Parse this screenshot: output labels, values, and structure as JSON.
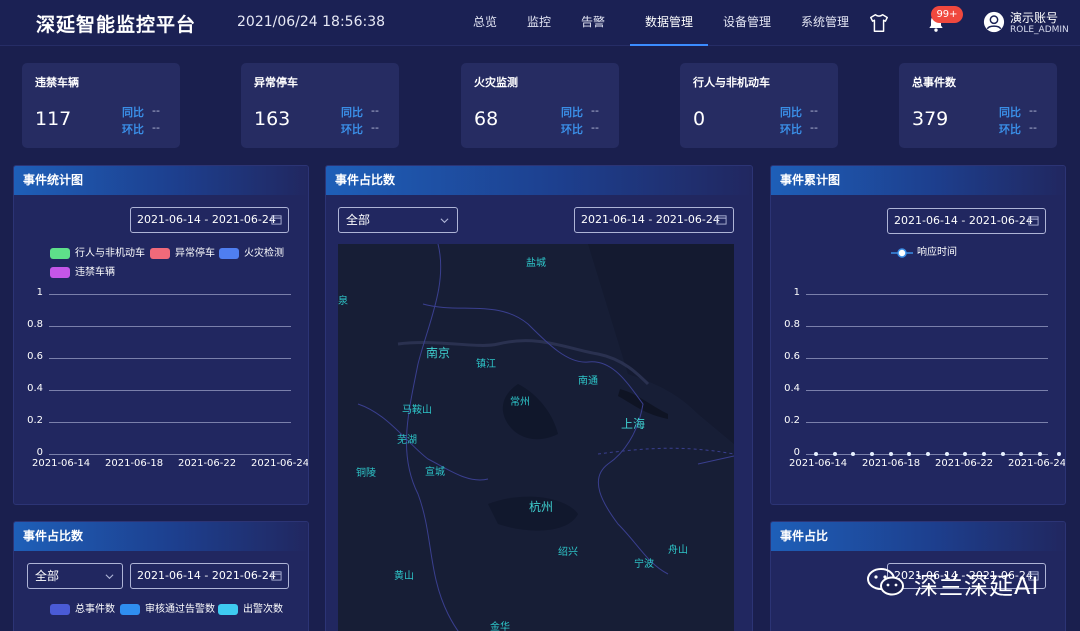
{
  "header": {
    "title": "深延智能监控平台",
    "datetime": "2021/06/24 18:56:38",
    "nav": [
      {
        "label": "总览"
      },
      {
        "label": "监控"
      },
      {
        "label": "告警"
      },
      {
        "label": "数据管理",
        "active": true
      },
      {
        "label": "设备管理"
      },
      {
        "label": "系统管理"
      }
    ],
    "notification_count": "99+",
    "user_name": "演示账号",
    "user_role": "ROLE_ADMIN"
  },
  "stats": [
    {
      "title": "违禁车辆",
      "value": "117",
      "yoy_label": "同比",
      "yoy_value": "--",
      "mom_label": "环比",
      "mom_value": "--"
    },
    {
      "title": "异常停车",
      "value": "163",
      "yoy_label": "同比",
      "yoy_value": "--",
      "mom_label": "环比",
      "mom_value": "--"
    },
    {
      "title": "火灾监测",
      "value": "68",
      "yoy_label": "同比",
      "yoy_value": "--",
      "mom_label": "环比",
      "mom_value": "--"
    },
    {
      "title": "行人与非机动车",
      "value": "0",
      "yoy_label": "同比",
      "yoy_value": "--",
      "mom_label": "环比",
      "mom_value": "--"
    },
    {
      "title": "总事件数",
      "value": "379",
      "yoy_label": "同比",
      "yoy_value": "--",
      "mom_label": "环比",
      "mom_value": "--"
    }
  ],
  "panel_event_stats": {
    "title": "事件统计图",
    "date_range": "2021-06-14 - 2021-06-24",
    "legend": [
      {
        "name": "行人与非机动车",
        "color": "#5ee08a"
      },
      {
        "name": "异常停车",
        "color": "#f06a7a"
      },
      {
        "name": "火灾检测",
        "color": "#4f7ef0"
      },
      {
        "name": "违禁车辆",
        "color": "#c456e8"
      }
    ]
  },
  "panel_event_ratio_map": {
    "title": "事件占比数",
    "select_value": "全部",
    "date_range": "2021-06-14 - 2021-06-24",
    "cities": [
      {
        "name": "盐城"
      },
      {
        "name": "泉"
      },
      {
        "name": "南京"
      },
      {
        "name": "镇江"
      },
      {
        "name": "南通"
      },
      {
        "name": "马鞍山"
      },
      {
        "name": "常州"
      },
      {
        "name": "上海"
      },
      {
        "name": "芜湖"
      },
      {
        "name": "铜陵"
      },
      {
        "name": "宣城"
      },
      {
        "name": "杭州"
      },
      {
        "name": "舟山"
      },
      {
        "name": "绍兴"
      },
      {
        "name": "宁波"
      },
      {
        "name": "黄山"
      },
      {
        "name": "金华"
      }
    ]
  },
  "panel_event_cumulative": {
    "title": "事件累计图",
    "date_range": "2021-06-14 - 2021-06-24",
    "legend_series": "响应时间"
  },
  "panel_event_ratio_bottom": {
    "title": "事件占比数",
    "select_value": "全部",
    "date_range": "2021-06-14 - 2021-06-24",
    "legend": [
      {
        "name": "总事件数",
        "color": "#4a5bd6"
      },
      {
        "name": "审核通过告警数",
        "color": "#2f8ef0"
      },
      {
        "name": "出警次数",
        "color": "#3ecbf0"
      }
    ]
  },
  "panel_event_share": {
    "title": "事件占比",
    "date_range": "2021-06-14 - 2021-06-24"
  },
  "watermark": {
    "text": "深兰深延AI"
  },
  "chart_data": [
    {
      "type": "bar",
      "categories": [
        "2021-06-14",
        "2021-06-18",
        "2021-06-22",
        "2021-06-24"
      ],
      "series": [
        {
          "name": "行人与非机动车",
          "values": []
        },
        {
          "name": "异常停车",
          "values": []
        },
        {
          "name": "火灾检测",
          "values": []
        },
        {
          "name": "违禁车辆",
          "values": []
        }
      ],
      "yticks": [
        "1",
        "0.8",
        "0.6",
        "0.4",
        "0.2",
        "0"
      ],
      "xticks": [
        "2021-06-14",
        "2021-06-18",
        "2021-06-22",
        "2021-06-24"
      ],
      "ylim": [
        0,
        1
      ],
      "grid": true,
      "legend": "top-left"
    },
    {
      "type": "line",
      "x": [
        "2021-06-14",
        "2021-06-15",
        "2021-06-16",
        "2021-06-17",
        "2021-06-18",
        "2021-06-19",
        "2021-06-20",
        "2021-06-21",
        "2021-06-22",
        "2021-06-23",
        "2021-06-24",
        "2021-06-25",
        "2021-06-26",
        "2021-06-27"
      ],
      "series": [
        {
          "name": "响应时间",
          "values": [
            0,
            0,
            0,
            0,
            0,
            0,
            0,
            0,
            0,
            0,
            0,
            0,
            0,
            0
          ]
        }
      ],
      "yticks": [
        "1",
        "0.8",
        "0.6",
        "0.4",
        "0.2",
        "0"
      ],
      "xticks": [
        "2021-06-14",
        "2021-06-18",
        "2021-06-22",
        "2021-06-24"
      ],
      "ylim": [
        0,
        1
      ],
      "grid": true,
      "legend": "top-center"
    }
  ]
}
